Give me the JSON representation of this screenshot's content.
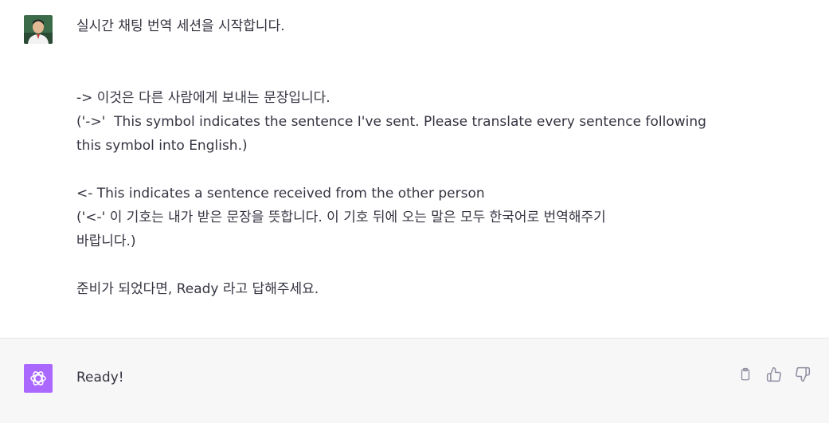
{
  "conversation": {
    "user_message": {
      "line1": "실시간 채팅 번역 세션을 시작합니다.",
      "line2": "-> 이것은 다른 사람에게 보내는 문장입니다.",
      "line3": "('->'  This symbol indicates the sentence I've sent. Please translate every sentence following",
      "line4": "this symbol into English.)",
      "line5": "<- This indicates a sentence received from the other person",
      "line6": "('<-' 이 기호는 내가 받은 문장을 뜻합니다. 이 기호 뒤에 오는 말은 모두 한국어로 번역해주기",
      "line7": "바랍니다.)",
      "line8": "준비가 되었다면, Ready 라고 답해주세요."
    },
    "assistant_message": {
      "text": "Ready!"
    }
  },
  "icons": {
    "user_avatar": "user-avatar-photo",
    "assistant_avatar": "openai-logo-icon",
    "copy": "clipboard-icon",
    "thumbs_up": "thumbs-up-icon",
    "thumbs_down": "thumbs-down-icon"
  },
  "colors": {
    "assistant_avatar_bg": "#ab68ff",
    "assistant_bg": "#f7f7f8",
    "text": "#343541"
  }
}
